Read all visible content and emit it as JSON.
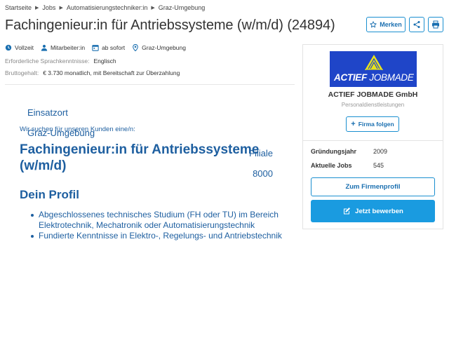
{
  "breadcrumb": {
    "items": [
      "Startseite",
      "Jobs",
      "Automatisierungstechniker:in",
      "Graz-Umgebung"
    ]
  },
  "job": {
    "title": "Fachingenieur:in für Antriebssysteme (w/m/d) (24894)"
  },
  "actions": {
    "merken_label": "Merken",
    "share_icon": "share-icon",
    "print_icon": "printer-icon"
  },
  "facts": {
    "employment": "Vollzeit",
    "role": "Mitarbeiter:in",
    "start": "ab sofort",
    "location": "Graz-Umgebung"
  },
  "meta": {
    "language_label": "Erforderliche Sprachkenntnisse:",
    "language_value": "Englisch",
    "salary_label": "Bruttogehalt:",
    "salary_value": "€ 3.730 monatlich, mit Bereitschaft zur Überzahlung"
  },
  "ad": {
    "einsatzort_label": "Einsatzort",
    "einsatzort_value": "Graz-Umgebung",
    "filiale_label": "Filiale",
    "filiale_value": "8000",
    "intro": "Wir suchen für unseren Kunden eine/n:",
    "title": "Fachingenieur:in für Antriebssysteme (w/m/d)",
    "profile_heading": "Dein Profil",
    "profile_items": [
      "Abgeschlossenes technisches Studium (FH oder TU) im Bereich Elektrotechnik, Mechatronik oder Automatisierungstechnik",
      "Fundierte Kenntnisse in Elektro-, Regelungs- und Antriebstechnik"
    ]
  },
  "company": {
    "logo_text_bold": "ACTIEF",
    "logo_text_rest": "JOBMADE",
    "name": "ACTIEF JOBMADE GmbH",
    "category": "Personaldienstleistungen",
    "follow_label": "Firma folgen",
    "stats": [
      {
        "label": "Gründungsjahr",
        "value": "2009"
      },
      {
        "label": "Aktuelle Jobs",
        "value": "545"
      }
    ],
    "profile_button": "Zum Firmenprofil",
    "apply_button": "Jetzt bewerben"
  },
  "colors": {
    "accent": "#1a9be0",
    "link": "#1e5fa0",
    "logo_bg": "#1f45c8",
    "logo_mark": "#e8e21c"
  }
}
